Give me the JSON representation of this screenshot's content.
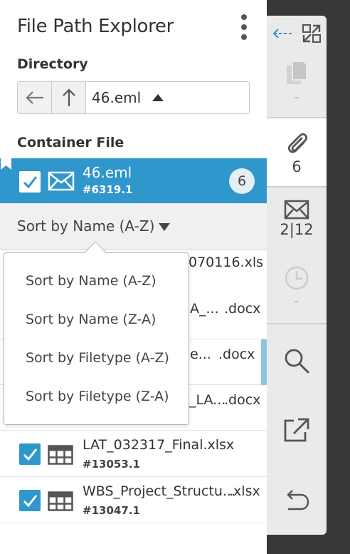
{
  "panel": {
    "title": "File Path Explorer",
    "directory_label": "Directory",
    "directory_value": "46.eml",
    "container_label": "Container File"
  },
  "container": {
    "name": "46.eml",
    "id": "#6319.1",
    "count": "6"
  },
  "sort": {
    "current": "Sort by Name (A-Z)",
    "options": [
      "Sort by Name (A-Z)",
      "Sort by Name (Z-A)",
      "Sort by Filetype (A-Z)",
      "Sort by Filetype (Z-A)"
    ]
  },
  "files": [
    {
      "name_visible": "070116.xls",
      "ext": ""
    },
    {
      "name_visible": "A_...",
      "ext": ".docx"
    },
    {
      "name_visible": "e...",
      "ext": ".docx"
    },
    {
      "name_visible": "_LA...",
      "ext": ".docx"
    },
    {
      "name": "LAT_032317_Final.xlsx",
      "id": "#13053.1"
    },
    {
      "name": "WBS_Project_Structu...",
      "ext": ".xlsx",
      "id": "#13047.1"
    }
  ],
  "rail": {
    "copy_label": "-",
    "attach_count": "6",
    "mail_count": "2|12",
    "clock_label": "-"
  },
  "colors": {
    "accent": "#2f97cb",
    "rail_bg": "#eaeaea",
    "dark_bg": "#373737",
    "sort_bar_bg": "#f0f0f0"
  },
  "icons": [
    "kebab-menu-icon",
    "arrow-left-icon",
    "arrow-up-icon",
    "bookmark-icon",
    "checkbox-checked-icon",
    "envelope-icon",
    "spreadsheet-icon",
    "collapse-arrow-icon",
    "expand-icon",
    "copy-icon",
    "paperclip-icon",
    "clock-icon",
    "search-icon",
    "external-link-icon",
    "undo-icon"
  ]
}
